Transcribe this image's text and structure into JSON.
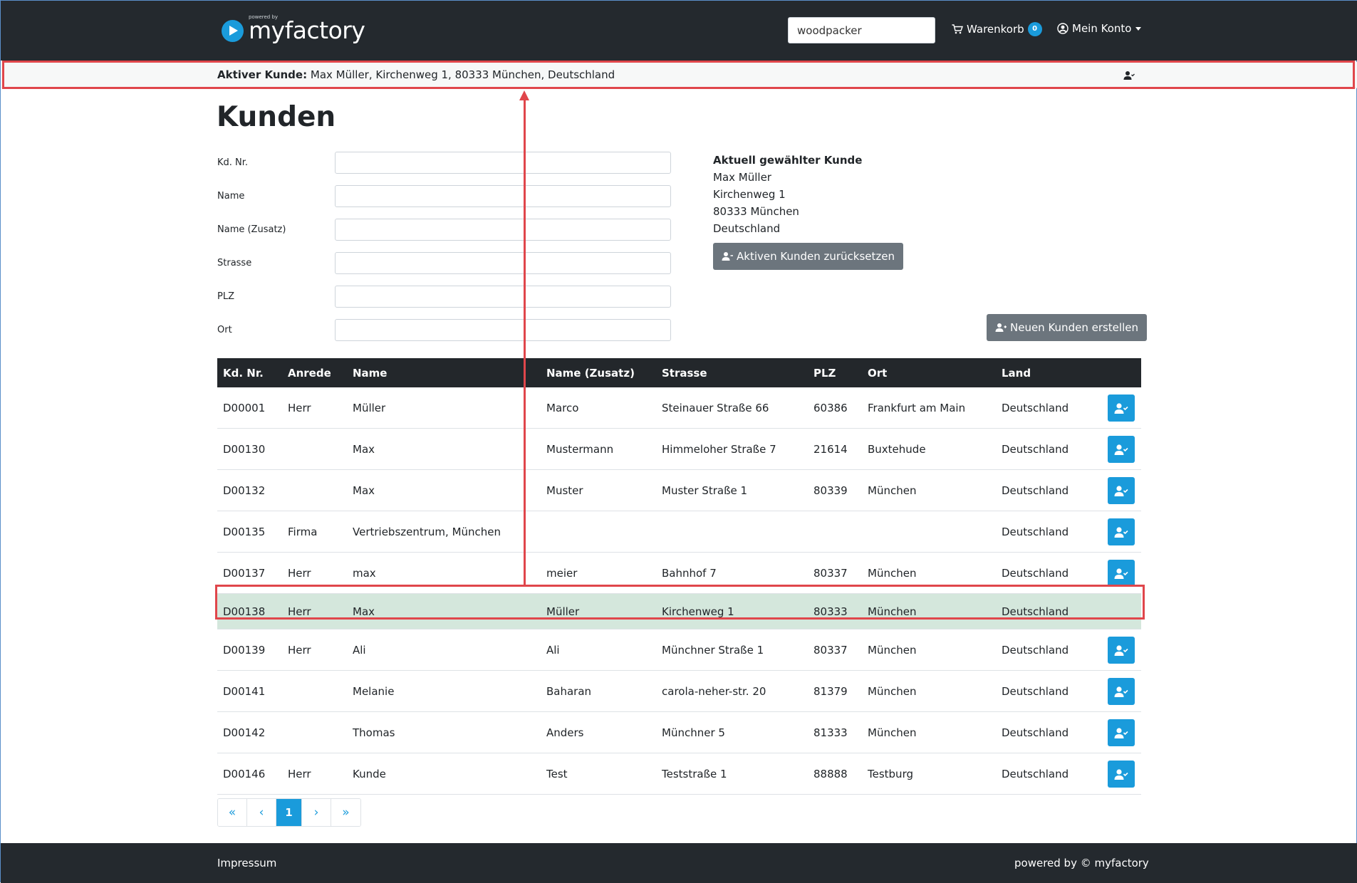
{
  "header": {
    "brand_powered": "powered by",
    "brand_name": "myfactory",
    "search_value": "woodpacker",
    "cart_label": "Warenkorb",
    "cart_count": "0",
    "account_label": "Mein Konto"
  },
  "active_customer": {
    "label": "Aktiver Kunde:",
    "value": "Max Müller, Kirchenweg 1, 80333 München, Deutschland"
  },
  "page_title": "Kunden",
  "filters": {
    "kdnr": "Kd. Nr.",
    "name": "Name",
    "name_zusatz": "Name (Zusatz)",
    "strasse": "Strasse",
    "plz": "PLZ",
    "ort": "Ort"
  },
  "selected_customer": {
    "title": "Aktuell gewählter Kunde",
    "name": "Max Müller",
    "street": "Kirchenweg 1",
    "city": "80333 München",
    "country": "Deutschland",
    "reset_button": "Aktiven Kunden zurücksetzen"
  },
  "new_customer_button": "Neuen Kunden erstellen",
  "table": {
    "headers": [
      "Kd. Nr.",
      "Anrede",
      "Name",
      "Name (Zusatz)",
      "Strasse",
      "PLZ",
      "Ort",
      "Land"
    ],
    "rows": [
      [
        "D00001",
        "Herr",
        "Müller",
        "Marco",
        "Steinauer Straße 66",
        "60386",
        "Frankfurt am Main",
        "Deutschland"
      ],
      [
        "D00130",
        "",
        "Max",
        "Mustermann",
        "Himmeloher Straße 7",
        "21614",
        "Buxtehude",
        "Deutschland"
      ],
      [
        "D00132",
        "",
        "Max",
        "Muster",
        "Muster Straße 1",
        "80339",
        "München",
        "Deutschland"
      ],
      [
        "D00135",
        "Firma",
        "Vertriebszentrum, München",
        "",
        "",
        "",
        "",
        "Deutschland"
      ],
      [
        "D00137",
        "Herr",
        "max",
        "meier",
        "Bahnhof 7",
        "80337",
        "München",
        "Deutschland"
      ],
      [
        "D00138",
        "Herr",
        "Max",
        "Müller",
        "Kirchenweg 1",
        "80333",
        "München",
        "Deutschland"
      ],
      [
        "D00139",
        "Herr",
        "Ali",
        "Ali",
        "Münchner Straße 1",
        "80337",
        "München",
        "Deutschland"
      ],
      [
        "D00141",
        "",
        "Melanie",
        "Baharan",
        "carola-neher-str. 20",
        "81379",
        "München",
        "Deutschland"
      ],
      [
        "D00142",
        "",
        "Thomas",
        "Anders",
        "Münchner 5",
        "81333",
        "München",
        "Deutschland"
      ],
      [
        "D00146",
        "Herr",
        "Kunde",
        "Test",
        "Teststraße 1",
        "88888",
        "Testburg",
        "Deutschland"
      ]
    ],
    "selected_row_index": 5
  },
  "pagination": {
    "first": "«",
    "prev": "‹",
    "current": "1",
    "next": "›",
    "last": "»"
  },
  "footer": {
    "impressum": "Impressum",
    "powered": "powered by © myfactory"
  },
  "colors": {
    "navbar": "#24292e",
    "accent": "#1a9bdb",
    "selected_row": "#d4e7dc",
    "annotation": "#e0464b"
  }
}
